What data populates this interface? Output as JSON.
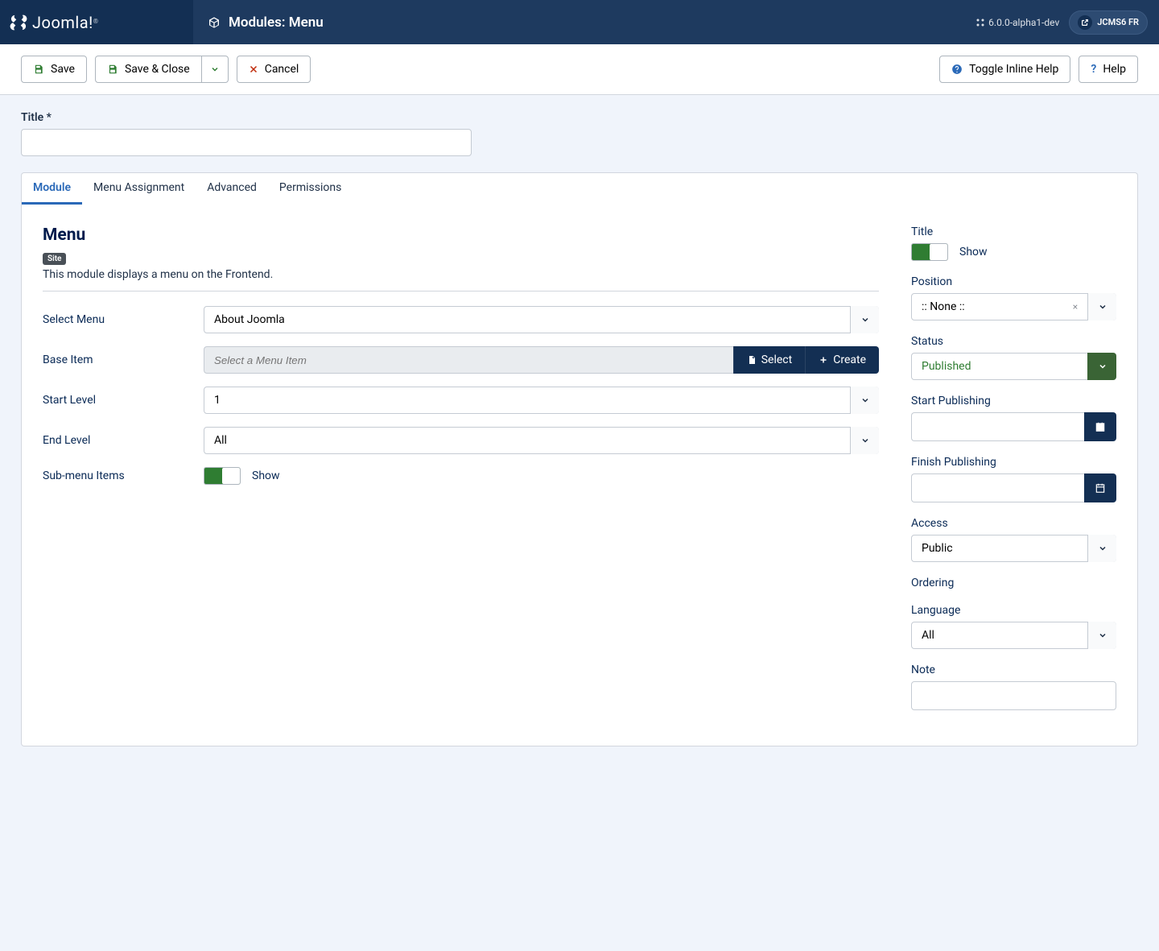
{
  "header": {
    "brand": "Joomla!",
    "title": "Modules: Menu",
    "version_prefix": "6.0.0-alpha1-dev",
    "profile": "JCMS6 FR"
  },
  "toolbar": {
    "save": "Save",
    "save_close": "Save & Close",
    "cancel": "Cancel",
    "toggle_help": "Toggle Inline Help",
    "help": "Help"
  },
  "title_field": {
    "label": "Title *",
    "value": ""
  },
  "tabs": [
    "Module",
    "Menu Assignment",
    "Advanced",
    "Permissions"
  ],
  "module": {
    "heading": "Menu",
    "badge": "Site",
    "desc": "This module displays a menu on the Frontend.",
    "fields": {
      "select_menu": {
        "label": "Select Menu",
        "value": "About Joomla"
      },
      "base_item": {
        "label": "Base Item",
        "placeholder": "Select a Menu Item",
        "select": "Select",
        "create": "Create"
      },
      "start_level": {
        "label": "Start Level",
        "value": "1"
      },
      "end_level": {
        "label": "End Level",
        "value": "All"
      },
      "sub_menu": {
        "label": "Sub-menu Items",
        "state": "Show"
      }
    }
  },
  "sidebar": {
    "title": {
      "label": "Title",
      "state": "Show"
    },
    "position": {
      "label": "Position",
      "value": ":: None ::"
    },
    "status": {
      "label": "Status",
      "value": "Published"
    },
    "start_publishing": {
      "label": "Start Publishing",
      "value": ""
    },
    "finish_publishing": {
      "label": "Finish Publishing",
      "value": ""
    },
    "access": {
      "label": "Access",
      "value": "Public"
    },
    "ordering": {
      "label": "Ordering"
    },
    "language": {
      "label": "Language",
      "value": "All"
    },
    "note": {
      "label": "Note",
      "value": ""
    }
  }
}
